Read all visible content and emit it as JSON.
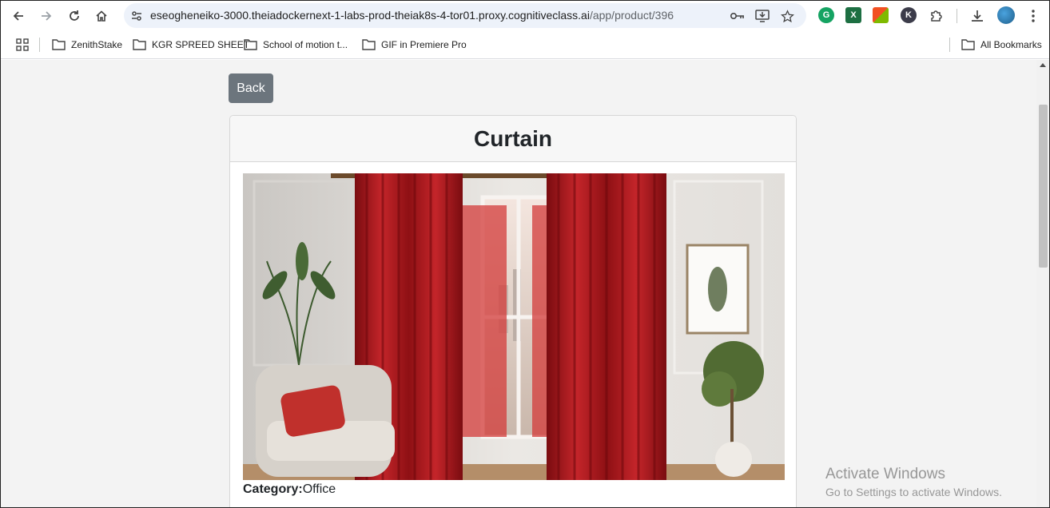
{
  "browser": {
    "url_domain": "eseogheneiko-3000.theiadockernext-1-labs-prod-theiak8s-4-tor01.proxy.cognitiveclass.ai",
    "url_path": "/app/product/396",
    "bookmarks": [
      "ZenithStake",
      "KGR SPREED SHEET",
      "School of motion t...",
      "GIF in Premiere Pro"
    ],
    "all_bookmarks_label": "All Bookmarks",
    "extension_letter_k": "K"
  },
  "page": {
    "back_label": "Back",
    "product_title": "Curtain",
    "category_label": "Category:",
    "category_value": "Office",
    "colors": {
      "back_button": "#6c757d",
      "curtain": "#b3191c"
    }
  },
  "watermark": {
    "line1": "Activate Windows",
    "line2": "Go to Settings to activate Windows."
  }
}
